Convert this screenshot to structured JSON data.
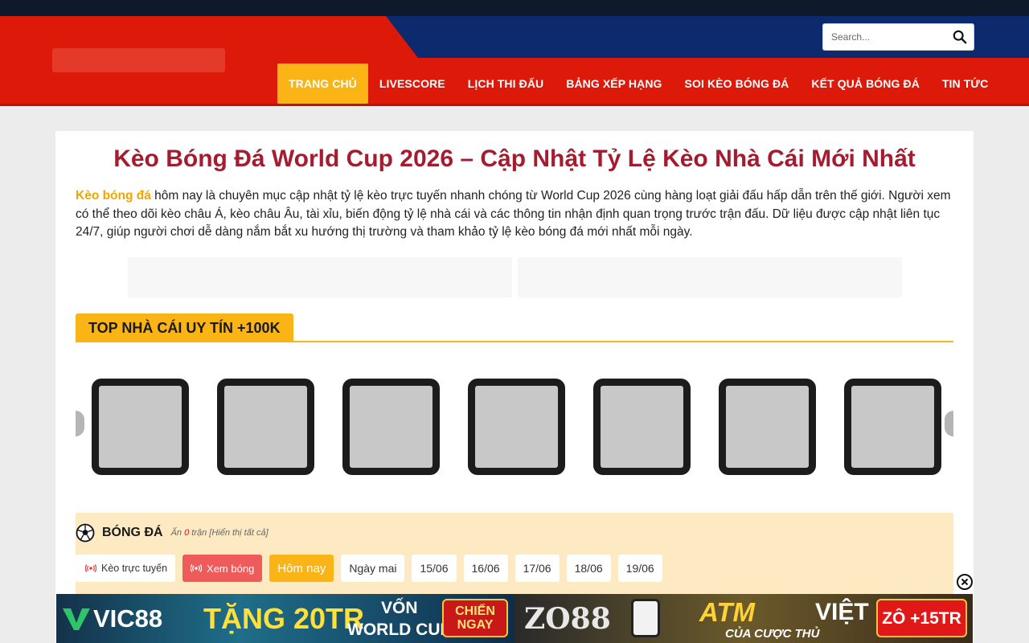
{
  "header": {
    "search": {
      "placeholder": "Search..."
    },
    "nav": [
      {
        "label": "TRANG CHỦ",
        "active": true
      },
      {
        "label": "LIVESCORE"
      },
      {
        "label": "LỊCH THI ĐẤU"
      },
      {
        "label": "BẢNG XẾP HẠNG"
      },
      {
        "label": "SOI KÈO BÓNG ĐÁ"
      },
      {
        "label": "KẾT QUẢ BÓNG ĐÁ"
      },
      {
        "label": "TIN TỨC"
      }
    ]
  },
  "main": {
    "title": "Kèo Bóng Đá World Cup 2026 – Cập Nhật Tỷ Lệ Kèo Nhà Cái Mới Nhất",
    "intro_highlight": "Kèo bóng đá",
    "intro_text": " hôm nay là chuyên mục cập nhật tỷ lệ kèo trực tuyến nhanh chóng từ World Cup 2026 cùng hàng loạt giải đấu hấp dẫn trên thế giới. Người xem có thể theo dõi kèo châu Á, kèo châu Âu, tài xỉu, biến động tỷ lệ nhà cái và các thông tin nhận định quan trọng trước trận đấu. Dữ liệu được cập nhật liên tục 24/7, giúp người chơi dễ dàng nắm bắt xu hướng thị trường và tham khảo tỷ lệ kèo bóng đá mới nhất mỗi ngày.",
    "section_title": "TOP NHÀ CÁI UY TÍN +100K",
    "sports": {
      "title": "BÓNG ĐÁ",
      "hidden_prefix": "Ẩn ",
      "hidden_count": "0",
      "hidden_suffix": " trận [Hiển thị tất cả]",
      "filters": {
        "live": "Kèo trực tuyến",
        "watch": "Xem bóng",
        "today": "Hôm nay",
        "tomorrow": "Ngày mai",
        "d1": "15/06",
        "d2": "16/06",
        "d3": "17/06",
        "d4": "18/06",
        "d5": "19/06"
      }
    }
  },
  "ads": {
    "vic": {
      "brand": "VIC88",
      "promo": "TẶNG 20TR",
      "sub1": "VỐN",
      "sub2": "WORLD CUP",
      "cta1": "CHIẾN",
      "cta2": "NGAY"
    },
    "zo": {
      "brand": "ZO88",
      "promo": "ATM",
      "promo2": "VIỆT",
      "sub": "CỦA CƯỢC THỦ",
      "cta": "ZÔ +15TR"
    }
  }
}
